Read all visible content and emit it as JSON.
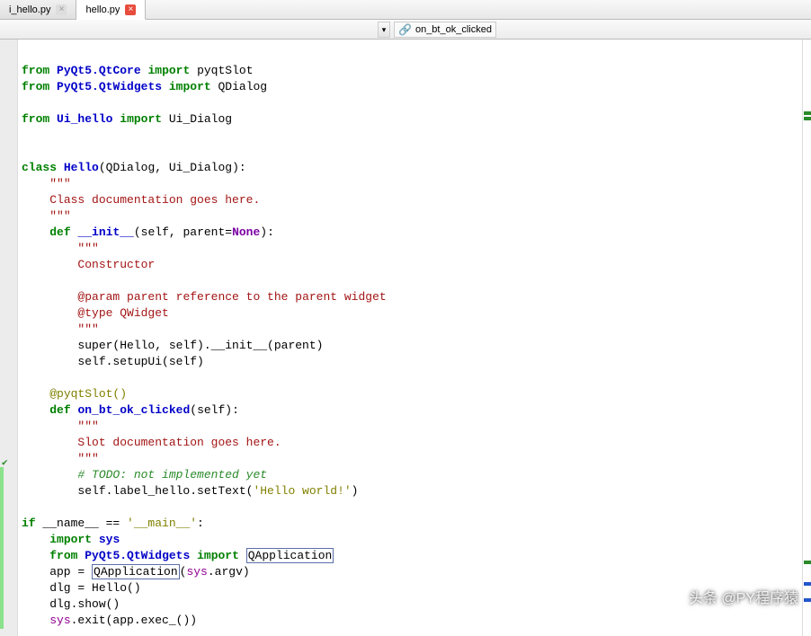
{
  "tabs": [
    {
      "label": "i_hello.py",
      "active": false,
      "close_style": "gray"
    },
    {
      "label": "hello.py",
      "active": true,
      "close_style": "red"
    }
  ],
  "toolbar": {
    "symbol": "on_bt_ok_clicked"
  },
  "code": {
    "lines": [
      {
        "t": "blank"
      },
      {
        "t": "import",
        "kw": "from",
        "mod": "PyQt5.QtCore",
        "kw2": "import",
        "name": "pyqtSlot"
      },
      {
        "t": "import",
        "kw": "from",
        "mod": "PyQt5.QtWidgets",
        "kw2": "import",
        "name": "QDialog"
      },
      {
        "t": "blank"
      },
      {
        "t": "import",
        "kw": "from",
        "mod": "Ui_hello",
        "kw2": "import",
        "name": "Ui_Dialog"
      },
      {
        "t": "blank"
      },
      {
        "t": "blank"
      },
      {
        "t": "classdef",
        "kw": "class",
        "name": "Hello",
        "args": "(QDialog, Ui_Dialog):"
      },
      {
        "t": "doc",
        "indent": 1,
        "text": "\"\"\""
      },
      {
        "t": "doc",
        "indent": 1,
        "text": "Class documentation goes here."
      },
      {
        "t": "doc",
        "indent": 1,
        "text": "\"\"\""
      },
      {
        "t": "funcdef",
        "indent": 1,
        "kw": "def",
        "name": "__init__",
        "args": "(self, parent=",
        "none": "None",
        "tail": "):"
      },
      {
        "t": "doc",
        "indent": 2,
        "text": "\"\"\""
      },
      {
        "t": "doc",
        "indent": 2,
        "text": "Constructor"
      },
      {
        "t": "blank"
      },
      {
        "t": "doc",
        "indent": 2,
        "text": "@param parent reference to the parent widget"
      },
      {
        "t": "doc",
        "indent": 2,
        "text": "@type QWidget"
      },
      {
        "t": "doc",
        "indent": 2,
        "text": "\"\"\""
      },
      {
        "t": "plain",
        "indent": 2,
        "text": "super(Hello, self).__init__(parent)"
      },
      {
        "t": "plain",
        "indent": 2,
        "text": "self.setupUi(self)"
      },
      {
        "t": "blank"
      },
      {
        "t": "deco",
        "indent": 1,
        "text": "@pyqtSlot()"
      },
      {
        "t": "funcdef",
        "indent": 1,
        "kw": "def",
        "name": "on_bt_ok_clicked",
        "args": "(self):"
      },
      {
        "t": "doc",
        "indent": 2,
        "text": "\"\"\""
      },
      {
        "t": "doc",
        "indent": 2,
        "text": "Slot documentation goes here."
      },
      {
        "t": "doc",
        "indent": 2,
        "text": "\"\"\""
      },
      {
        "t": "todo",
        "indent": 2,
        "text": "# TODO: not implemented yet"
      },
      {
        "t": "settext",
        "indent": 2,
        "pre": "self.label_hello.setText(",
        "str": "'Hello world!'",
        "post": ")"
      },
      {
        "t": "blank"
      },
      {
        "t": "ifmain",
        "kw": "if",
        "var": "__name__",
        "op": " == ",
        "str": "'__main__'",
        "tail": ":"
      },
      {
        "t": "importsys",
        "indent": 1,
        "kw": "import",
        "mod": "sys"
      },
      {
        "t": "importbox",
        "indent": 1,
        "kw": "from",
        "mod": "PyQt5.QtWidgets",
        "kw2": "import",
        "name": "QApplication"
      },
      {
        "t": "appline",
        "indent": 1,
        "pre": "app = ",
        "box": "QApplication",
        "mid": "(",
        "blt": "sys",
        "post": ".argv)"
      },
      {
        "t": "plain",
        "indent": 1,
        "text": "dlg = Hello()"
      },
      {
        "t": "plain",
        "indent": 1,
        "text": "dlg.show()"
      },
      {
        "t": "exitline",
        "indent": 1,
        "blt": "sys",
        "post": ".exit(app.exec_())"
      }
    ]
  },
  "watermark": "头条 @PY程序猿"
}
